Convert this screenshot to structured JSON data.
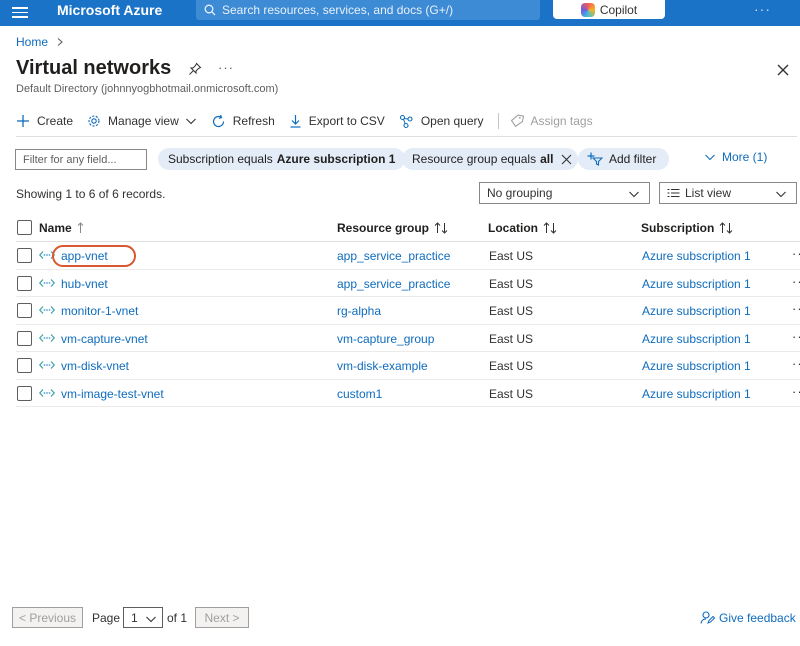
{
  "topbar": {
    "brand": "Microsoft Azure",
    "search_placeholder": "Search resources, services, and docs (G+/)",
    "copilot_label": "Copilot",
    "more": "···"
  },
  "breadcrumb": {
    "home": "Home"
  },
  "page": {
    "title": "Virtual networks",
    "subtitle": "Default Directory (johnnyogbhotmail.onmicrosoft.com)",
    "more": "···"
  },
  "commands": {
    "create": "Create",
    "manage_view": "Manage view",
    "refresh": "Refresh",
    "export_csv": "Export to CSV",
    "open_query": "Open query",
    "assign_tags": "Assign tags"
  },
  "filters": {
    "placeholder": "Filter for any field...",
    "subscription_prefix": "Subscription equals",
    "subscription_value": "Azure subscription 1",
    "rg_prefix": "Resource group equals",
    "rg_value": "all",
    "add_filter": "Add filter",
    "more": "More (1)"
  },
  "records": {
    "summary": "Showing 1 to 6 of 6 records.",
    "grouping": "No grouping",
    "view": "List view"
  },
  "table": {
    "columns": {
      "name": "Name",
      "resource_group": "Resource group",
      "location": "Location",
      "subscription": "Subscription"
    },
    "rows": [
      {
        "name": "app-vnet",
        "resource_group": "app_service_practice",
        "location": "East US",
        "subscription": "Azure subscription 1"
      },
      {
        "name": "hub-vnet",
        "resource_group": "app_service_practice",
        "location": "East US",
        "subscription": "Azure subscription 1"
      },
      {
        "name": "monitor-1-vnet",
        "resource_group": "rg-alpha",
        "location": "East US",
        "subscription": "Azure subscription 1"
      },
      {
        "name": "vm-capture-vnet",
        "resource_group": "vm-capture_group",
        "location": "East US",
        "subscription": "Azure subscription 1"
      },
      {
        "name": "vm-disk-vnet",
        "resource_group": "vm-disk-example",
        "location": "East US",
        "subscription": "Azure subscription 1"
      },
      {
        "name": "vm-image-test-vnet",
        "resource_group": "custom1",
        "location": "East US",
        "subscription": "Azure subscription 1"
      }
    ],
    "row_more": "··"
  },
  "pager": {
    "previous": "< Previous",
    "page_label": "Page",
    "page_value": "1",
    "of_label": "of 1",
    "next": "Next >"
  },
  "feedback": "Give feedback",
  "colors": {
    "topbar": "#1a73c6",
    "link": "#0f6cbd",
    "pill": "#e3ecf7",
    "highlight": "#d8582f"
  }
}
